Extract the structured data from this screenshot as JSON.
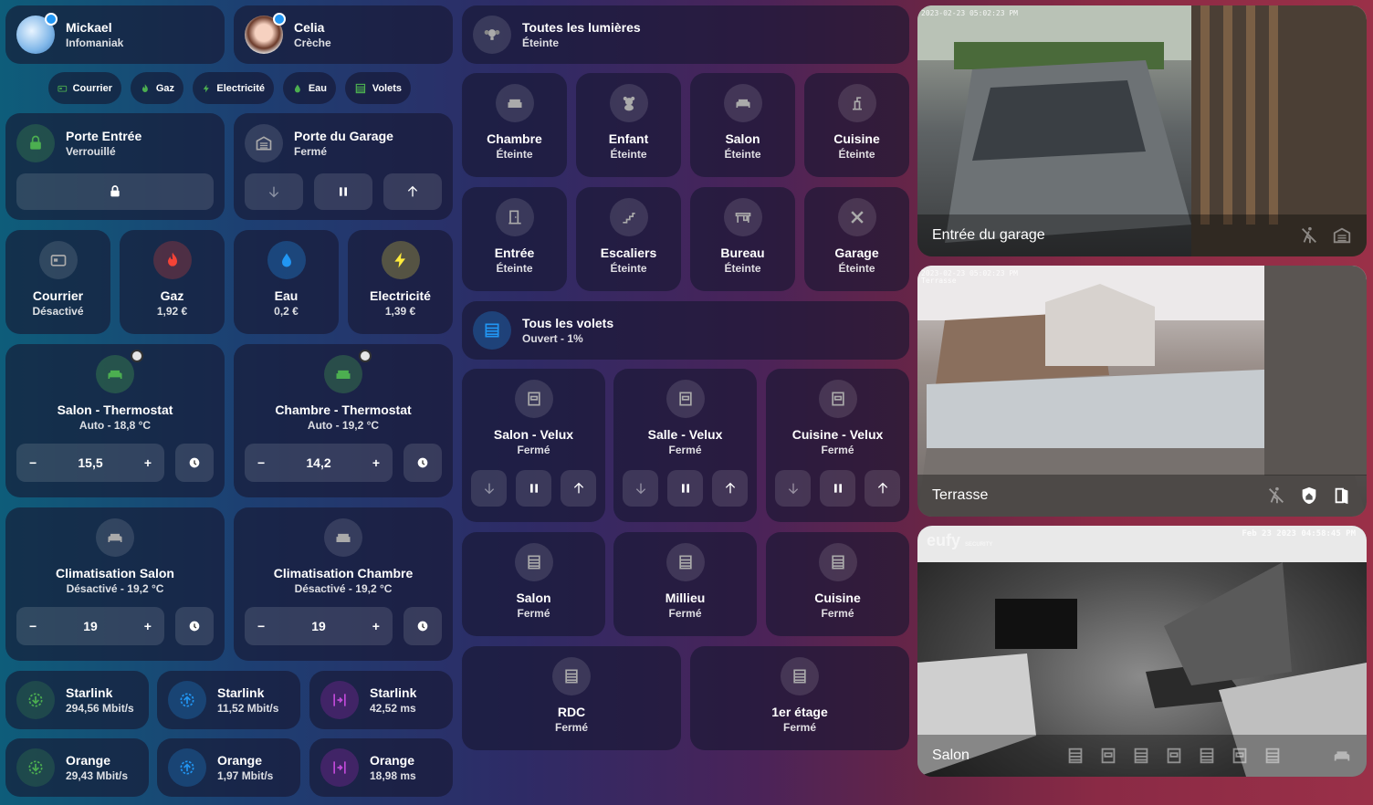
{
  "people": [
    {
      "name": "Mickael",
      "status": "Infomaniak"
    },
    {
      "name": "Celia",
      "status": "Crèche"
    }
  ],
  "chips": [
    "Courrier",
    "Gaz",
    "Electricité",
    "Eau",
    "Volets"
  ],
  "locks": {
    "porte": {
      "title": "Porte Entrée",
      "state": "Verrouillé"
    },
    "garage": {
      "title": "Porte du Garage",
      "state": "Fermé"
    }
  },
  "sensors": [
    {
      "title": "Courrier",
      "state": "Désactivé"
    },
    {
      "title": "Gaz",
      "state": "1,92 €"
    },
    {
      "title": "Eau",
      "state": "0,2 €"
    },
    {
      "title": "Electricité",
      "state": "1,39 €"
    }
  ],
  "thermostats": [
    {
      "title": "Salon - Thermostat",
      "state": "Auto - 18,8 °C",
      "target": "15,5"
    },
    {
      "title": "Chambre - Thermostat",
      "state": "Auto - 19,2 °C",
      "target": "14,2"
    }
  ],
  "climates": [
    {
      "title": "Climatisation Salon",
      "state": "Désactivé - 19,2 °C",
      "target": "19"
    },
    {
      "title": "Climatisation Chambre",
      "state": "Désactivé - 19,2 °C",
      "target": "19"
    }
  ],
  "network": [
    {
      "title": "Starlink",
      "value": "294,56 Mbit/s"
    },
    {
      "title": "Starlink",
      "value": "11,52 Mbit/s"
    },
    {
      "title": "Starlink",
      "value": "42,52 ms"
    },
    {
      "title": "Orange",
      "value": "29,43 Mbit/s"
    },
    {
      "title": "Orange",
      "value": "1,97 Mbit/s"
    },
    {
      "title": "Orange",
      "value": "18,98 ms"
    }
  ],
  "all_lights": {
    "title": "Toutes les lumières",
    "state": "Éteinte"
  },
  "lights": [
    {
      "title": "Chambre",
      "state": "Éteinte"
    },
    {
      "title": "Enfant",
      "state": "Éteinte"
    },
    {
      "title": "Salon",
      "state": "Éteinte"
    },
    {
      "title": "Cuisine",
      "state": "Éteinte"
    },
    {
      "title": "Entrée",
      "state": "Éteinte"
    },
    {
      "title": "Escaliers",
      "state": "Éteinte"
    },
    {
      "title": "Bureau",
      "state": "Éteinte"
    },
    {
      "title": "Garage",
      "state": "Éteinte"
    }
  ],
  "all_shutters": {
    "title": "Tous les volets",
    "state": "Ouvert - 1%"
  },
  "velux": [
    {
      "title": "Salon - Velux",
      "state": "Fermé"
    },
    {
      "title": "Salle - Velux",
      "state": "Fermé"
    },
    {
      "title": "Cuisine - Velux",
      "state": "Fermé"
    }
  ],
  "shutters": [
    {
      "title": "Salon",
      "state": "Fermé"
    },
    {
      "title": "Millieu",
      "state": "Fermé"
    },
    {
      "title": "Cuisine",
      "state": "Fermé"
    },
    {
      "title": "RDC",
      "state": "Fermé"
    },
    {
      "title": "1er étage",
      "state": "Fermé"
    }
  ],
  "cameras": [
    {
      "name": "Entrée du garage",
      "ts": "2023-02-23 05:02:23 PM"
    },
    {
      "name": "Terrasse",
      "ts": "2023-02-23 05:02:23 PM",
      "sub": "Terrasse"
    },
    {
      "name": "Salon",
      "ts": "Feb 23 2023   04:58:45 PM",
      "brand": "eufy",
      "brand_sub": "SECURITY"
    }
  ],
  "colors": {
    "green": "#4caf50",
    "red": "#f44336",
    "blue": "#2196f3",
    "yellow": "#ffeb3b",
    "purple": "#9c27b0"
  }
}
